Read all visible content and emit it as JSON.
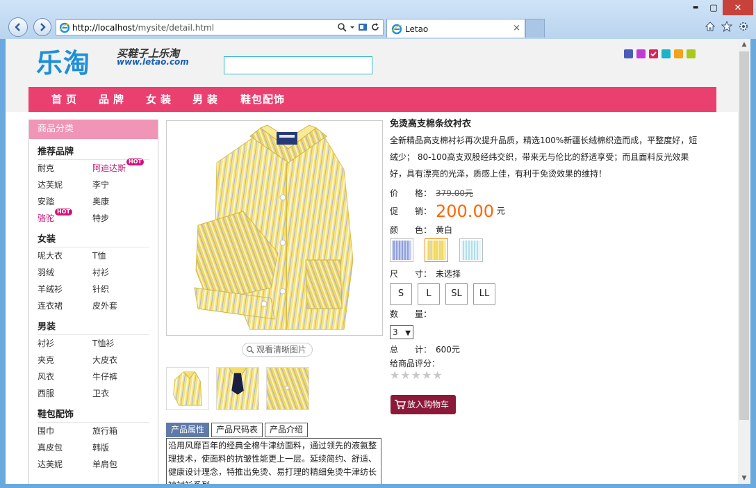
{
  "browser": {
    "url_host": "http://localhost",
    "url_path": "/mysite/detail.html",
    "tab_title": "Letao",
    "tab_close": "×",
    "min": "▬",
    "max": "▢",
    "close": "✕"
  },
  "header": {
    "logo_text": "乐淘",
    "slogan": "买鞋子上乐淘",
    "logo_url": "www.letao.com",
    "search_value": "",
    "swatch_colors": [
      "#4a5bb8",
      "#c13ad4",
      "#d8245c",
      "#1ab3c8",
      "#f3a21b",
      "#a8c81e"
    ]
  },
  "nav": {
    "items": [
      "首页",
      "品牌",
      "女装",
      "男装",
      "鞋包配饰"
    ]
  },
  "sidebar": {
    "heading": "商品分类",
    "categories": [
      {
        "title": "推荐品牌",
        "items": [
          {
            "label": "耐克",
            "hot": false
          },
          {
            "label": "阿迪达斯",
            "hot": true
          },
          {
            "label": "达芙妮",
            "hot": false
          },
          {
            "label": "李宁",
            "hot": false
          },
          {
            "label": "安踏",
            "hot": false
          },
          {
            "label": "奥康",
            "hot": false
          },
          {
            "label": "骆驼",
            "hot": true
          },
          {
            "label": "特步",
            "hot": false
          }
        ]
      },
      {
        "title": "女装",
        "items": [
          {
            "label": "呢大衣",
            "hot": false
          },
          {
            "label": "T恤",
            "hot": false
          },
          {
            "label": "羽绒",
            "hot": false
          },
          {
            "label": "衬衫",
            "hot": false
          },
          {
            "label": "羊绒衫",
            "hot": false
          },
          {
            "label": "针织",
            "hot": false
          },
          {
            "label": "连衣裙",
            "hot": false
          },
          {
            "label": "皮外套",
            "hot": false
          }
        ]
      },
      {
        "title": "男装",
        "items": [
          {
            "label": "衬衫",
            "hot": false
          },
          {
            "label": "T恤衫",
            "hot": false
          },
          {
            "label": "夹克",
            "hot": false
          },
          {
            "label": "大皮衣",
            "hot": false
          },
          {
            "label": "风衣",
            "hot": false
          },
          {
            "label": "牛仔裤",
            "hot": false
          },
          {
            "label": "西服",
            "hot": false
          },
          {
            "label": "卫衣",
            "hot": false
          }
        ]
      },
      {
        "title": "鞋包配饰",
        "items": [
          {
            "label": "围巾",
            "hot": false
          },
          {
            "label": "旅行箱",
            "hot": false
          },
          {
            "label": "真皮包",
            "hot": false
          },
          {
            "label": "韩版",
            "hot": false
          },
          {
            "label": "达芙妮",
            "hot": false
          },
          {
            "label": "单肩包",
            "hot": false
          }
        ]
      }
    ],
    "hot_label": "HOT"
  },
  "product": {
    "title": "免烫高支棉条纹衬衣",
    "description": "全新精品高支棉衬衫再次提升品质，精选100%新疆长绒棉织造而成，平整度好，短绒少； 80-100高支双股经纬交织，带来无与伦比的舒适享受；而且面料反光效果好，具有漂亮的光泽，质感上佳，有利于免烫效果的维持！",
    "price_label": "价　　格：",
    "price": "379.00元",
    "promo_label": "促　　销：",
    "promo_price": "200.00",
    "promo_unit": "元",
    "color_label": "颜　　色：",
    "color_value": "黄白",
    "size_label": "尺　　寸：",
    "size_value": "未选择",
    "sizes": [
      "S",
      "L",
      "SL",
      "LL"
    ],
    "qty_label": "数　　量：",
    "qty_value": "3",
    "total_label": "总　　计：",
    "total_value": "600元",
    "rating_label": "给商品评分：",
    "rating": 0,
    "cart_label": "放入购物车",
    "zoom_label": "观看清晰图片",
    "tabs": [
      "产品属性",
      "产品尺码表",
      "产品介绍"
    ],
    "active_tab": 0,
    "tab_text": "沿用风靡百年的经典全棉牛津纺面料，通过领先的液氨整理技术，使面料的抗皱性能更上一层。延续简约、舒适、健康设计理念，特推出免烫、易打理的精细免烫牛津纺长袖衬衫系列。"
  }
}
